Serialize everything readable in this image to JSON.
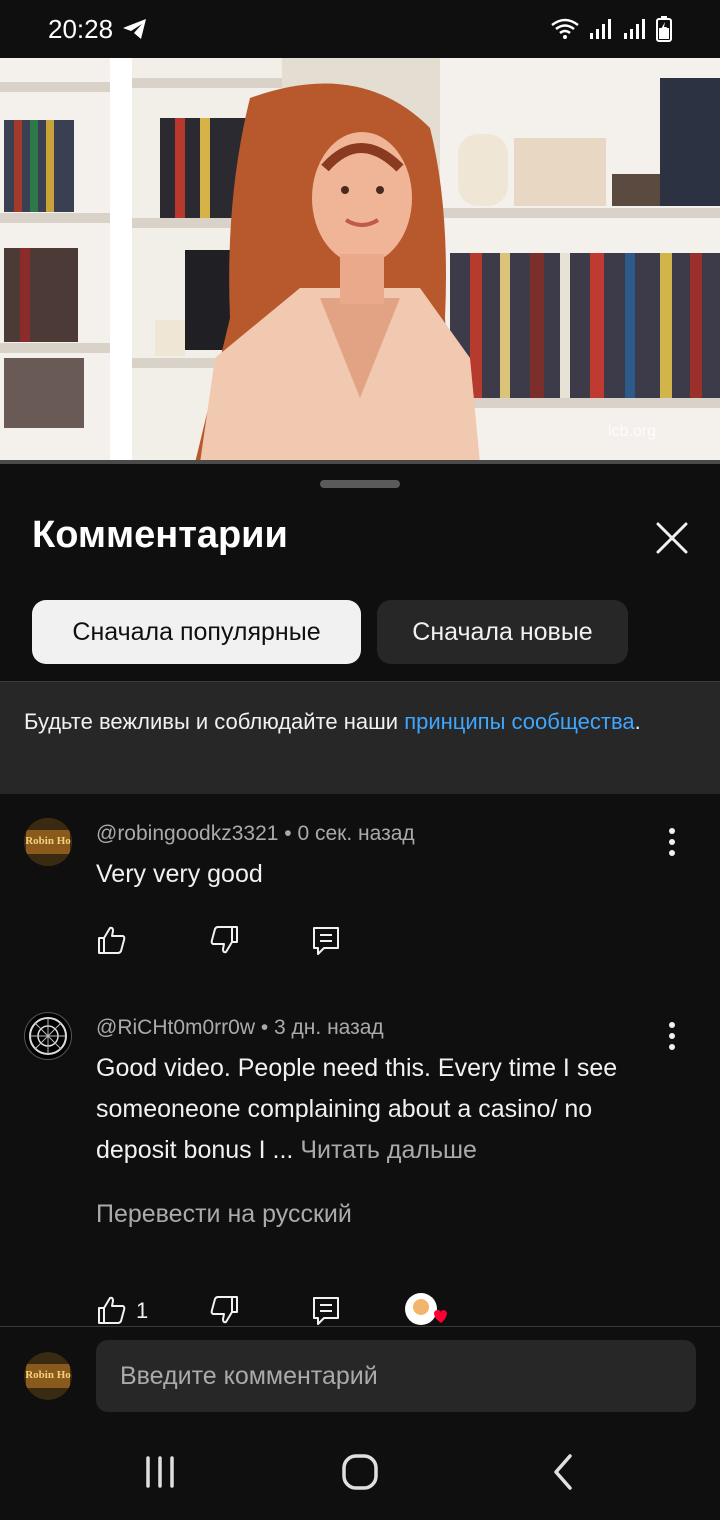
{
  "status_bar": {
    "time": "20:28"
  },
  "video": {
    "watermark": "lcb.org"
  },
  "panel": {
    "title": "Комментарии",
    "sort_chips": [
      {
        "label": "Сначала популярные",
        "active": true
      },
      {
        "label": "Сначала новые",
        "active": false
      }
    ],
    "notice": {
      "text": "Будьте вежливы и соблюдайте наши ",
      "link": "принципы сообщества",
      "end": "."
    }
  },
  "comments": [
    {
      "author": "@robingoodkz3321",
      "time": "0 сек. назад",
      "text": "Very very good",
      "avatar_text": "Robin Ho",
      "likes": ""
    },
    {
      "author": "@RiCHt0m0rr0w",
      "time": "3 дн. назад",
      "text": "Good video. People need this. Every time I see someoneone complaining about a casino/ no deposit bonus I ...",
      "read_more": "Читать дальше",
      "translate": "Перевести на русский",
      "likes": "1"
    }
  ],
  "composer": {
    "placeholder": "Введите комментарий",
    "avatar_text": "Robin Ho"
  },
  "colors": {
    "accent_link": "#3ea6ff",
    "background": "#0f0f0f",
    "surface": "#272727",
    "heart": "#ff0033"
  },
  "icons": [
    "telegram-icon",
    "wifi-icon",
    "signal-icon",
    "battery-icon",
    "close-icon",
    "more-vert-icon",
    "thumb-up-icon",
    "thumb-down-icon",
    "reply-icon",
    "creator-heart-icon",
    "recents-icon",
    "home-icon",
    "back-icon"
  ]
}
